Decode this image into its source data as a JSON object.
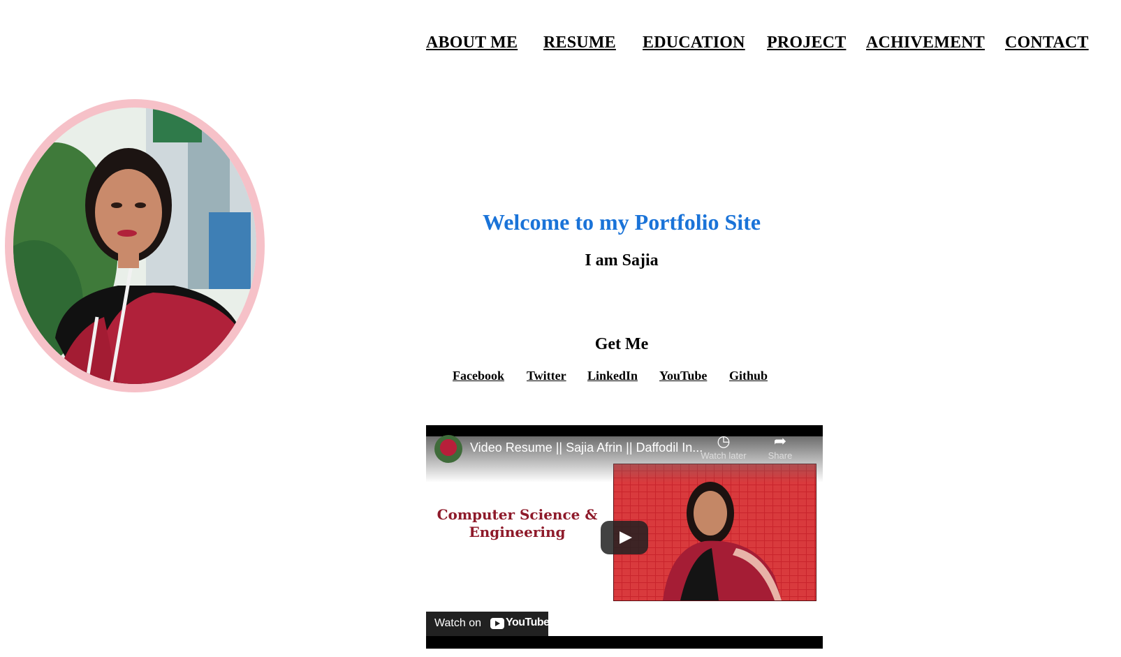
{
  "nav": {
    "items": [
      {
        "label": "ABOUT ME"
      },
      {
        "label": "RESUME"
      },
      {
        "label": "EDUCATION"
      },
      {
        "label": "PROJECT"
      },
      {
        "label": "ACHIVEMENT"
      },
      {
        "label": "CONTACT"
      }
    ]
  },
  "hero": {
    "title": "Welcome to my Portfolio Site",
    "subtitle": "I am Sajia"
  },
  "get_me": {
    "title": "Get Me",
    "links": [
      {
        "label": "Facebook "
      },
      {
        "label": "Twitter "
      },
      {
        "label": "LinkedIn "
      },
      {
        "label": "YouTube "
      },
      {
        "label": "Github "
      }
    ]
  },
  "video": {
    "title": "Video Resume || Sajia Afrin || Daffodil In...",
    "watch_later": "Watch later",
    "share": "Share",
    "thumbnail_text": "Computer Science & Engineering",
    "watch_on": "Watch on",
    "youtube_word": "YouTube"
  },
  "colors": {
    "accent": "#1a73d8",
    "profile_border": "#f6c1c8",
    "thumbnail_red": "#8e1a2a"
  }
}
